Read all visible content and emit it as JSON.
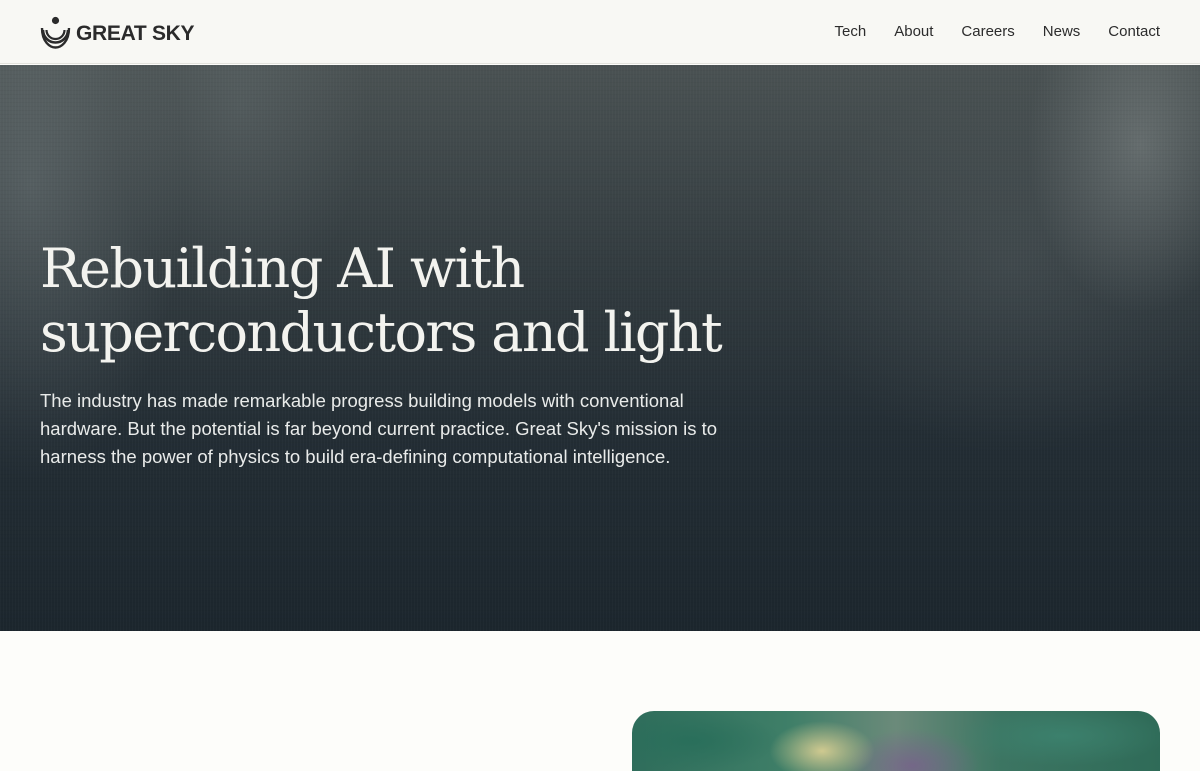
{
  "brand": {
    "name": "GREAT SKY",
    "logo_icon": "great-sky-logo-icon"
  },
  "nav": {
    "items": [
      {
        "label": "Tech"
      },
      {
        "label": "About"
      },
      {
        "label": "Careers"
      },
      {
        "label": "News"
      },
      {
        "label": "Contact"
      }
    ]
  },
  "hero": {
    "title_line1": "Rebuilding AI with",
    "title_line2": "superconductors and light",
    "body": "The industry has made remarkable progress building models with conventional hardware. But the potential is far beyond current practice. Great Sky's mission is to harness the power of physics to build era-defining computational intelligence."
  },
  "colors": {
    "nav_background": "#f8f8f4",
    "hero_dark": "#1c262d",
    "hero_text": "#f3f3ef",
    "page_background": "#fdfdfa"
  }
}
